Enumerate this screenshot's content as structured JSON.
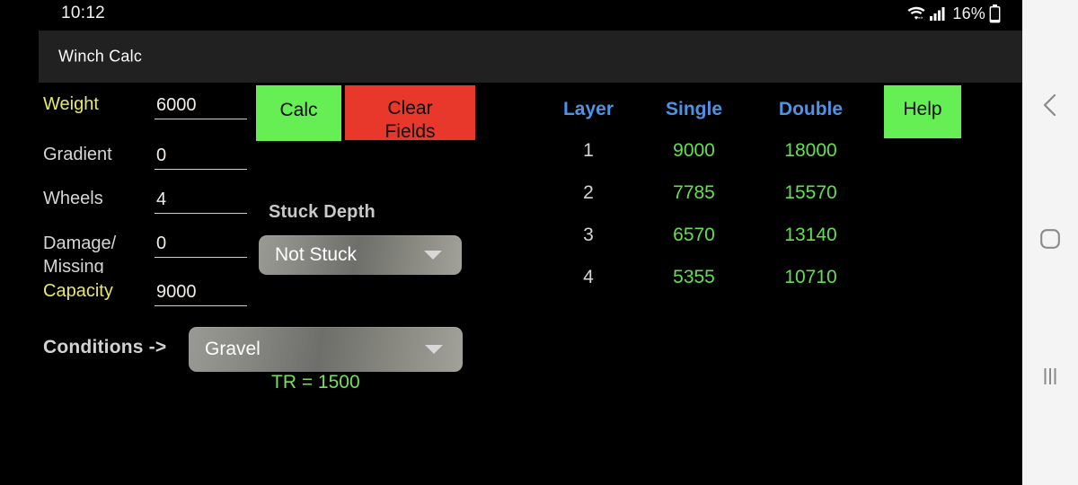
{
  "status_bar": {
    "clock": "10:12",
    "battery_percent": "16%",
    "icons": [
      "wifi-icon",
      "cellular-signal-icon",
      "battery-icon"
    ]
  },
  "app_bar": {
    "title": "Winch Calc"
  },
  "colors": {
    "background": "#000000",
    "app_bar": "#212121",
    "accent_label": "#e8e86b",
    "label": "#d6d6d6",
    "value": "#f0ece8",
    "calc_button": "#66ee55",
    "clear_button": "#e8382b",
    "help_button": "#66ee55",
    "table_header": "#4d93e8",
    "table_value": "#63e04e",
    "tr_value": "#74e05a",
    "nav_bar": "#f4f4f4"
  },
  "form": {
    "fields": [
      {
        "label": "Weight",
        "value": "6000",
        "accent": true
      },
      {
        "label": "Gradient",
        "value": "0",
        "accent": false
      },
      {
        "label": "Wheels",
        "value": "4",
        "accent": false
      },
      {
        "label": "Damage/\nMissing",
        "value": "0",
        "accent": false
      },
      {
        "label": "Capacity",
        "value": "9000",
        "accent": true
      }
    ]
  },
  "buttons": {
    "calc": "Calc",
    "clear": "Clear\nFields",
    "help": "Help"
  },
  "stuck_depth": {
    "label": "Stuck Depth",
    "selected": "Not Stuck",
    "tr_text": "TR = 1500"
  },
  "conditions": {
    "label": "Conditions ->",
    "selected": "Gravel"
  },
  "results": {
    "headers": [
      "Layer",
      "Single",
      "Double"
    ],
    "rows": [
      {
        "layer": "1",
        "single": "9000",
        "double": "18000"
      },
      {
        "layer": "2",
        "single": "7785",
        "double": "15570"
      },
      {
        "layer": "3",
        "single": "6570",
        "double": "13140"
      },
      {
        "layer": "4",
        "single": "5355",
        "double": "10710"
      }
    ]
  },
  "nav_bar": {
    "back": "back-icon",
    "home": "home-icon",
    "recents": "recents-icon"
  }
}
